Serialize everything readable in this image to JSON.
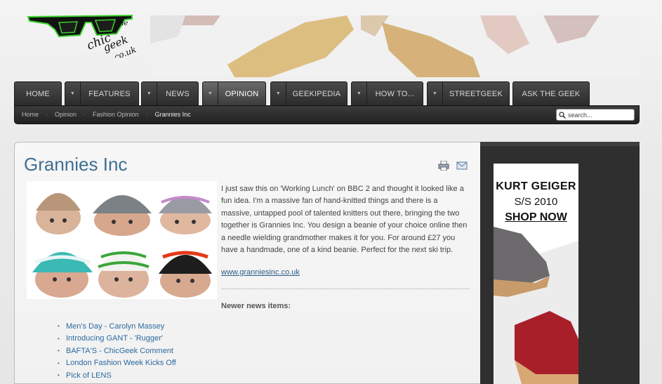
{
  "header": {
    "logo_text": "the chic geek co.uk"
  },
  "nav": {
    "tabs": [
      {
        "label": "HOME",
        "has_arrow": false,
        "active": false
      },
      {
        "label": "FEATURES",
        "has_arrow": true,
        "active": false
      },
      {
        "label": "NEWS",
        "has_arrow": true,
        "active": false
      },
      {
        "label": "OPINION",
        "has_arrow": true,
        "active": true
      },
      {
        "label": "GEEKIPEDIA",
        "has_arrow": true,
        "active": false
      },
      {
        "label": "HOW TO...",
        "has_arrow": true,
        "active": false
      },
      {
        "label": "STREETGEEK",
        "has_arrow": true,
        "active": false
      },
      {
        "label": "ASK THE GEEK",
        "has_arrow": false,
        "active": false
      }
    ]
  },
  "breadcrumb": [
    "Home",
    "Opinion",
    "Fashion Opinion",
    "Grannies Inc"
  ],
  "search": {
    "placeholder": "search..."
  },
  "article": {
    "title": "Grannies Inc",
    "body": "I just saw this on 'Working Lunch' on BBC 2 and thought it looked like a fun idea. I'm a massive fan of hand-knitted things and there is a massive, untapped pool of talented knitters out there, bringing the two together is Grannies Inc. You design a beanie of your choice online then a needle wielding grandmother makes it for you. For around £27 you have a handmade, one of a kind beanie. Perfect for the next ski trip.",
    "link": "www.granniesinc.co.uk",
    "newer_heading": "Newer news items:",
    "newer_items": [
      "Men's Day - Carolyn Massey",
      "Introducing GANT - 'Rugger'",
      "BAFTA'S - ChicGeek Comment",
      "London Fashion Week Kicks Off",
      "Pick of LENS"
    ]
  },
  "ad": {
    "line1": "KURT GEIGER",
    "line2": "S/S 2010",
    "line3": "SHOP NOW"
  },
  "colors": {
    "title": "#3f6f93",
    "link": "#2c6aa0",
    "nav_bg": "#2c2c2c",
    "logo_green": "#3ad12a"
  }
}
